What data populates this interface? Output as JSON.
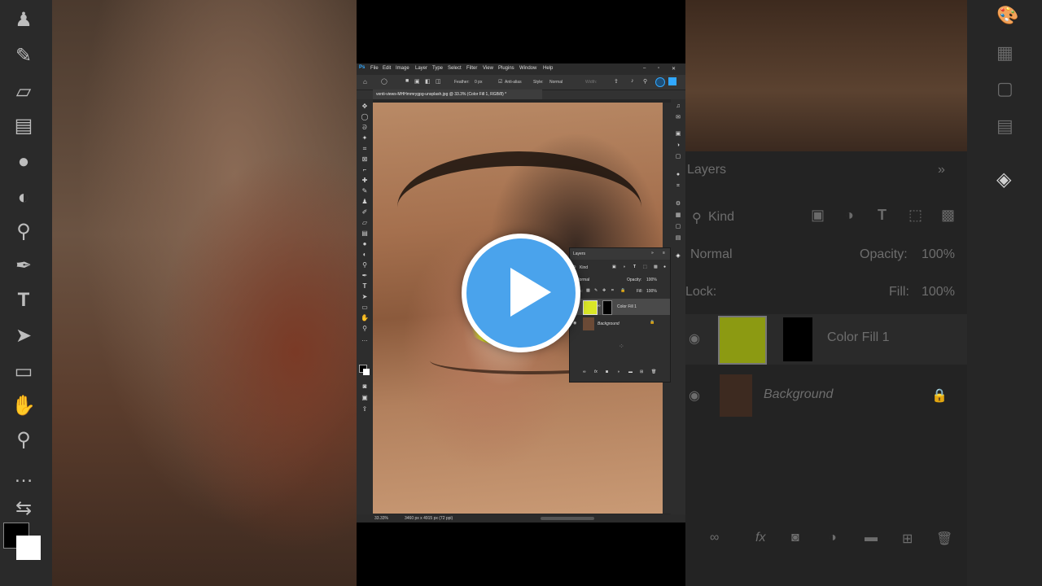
{
  "menu": [
    "File",
    "Edit",
    "Image",
    "Layer",
    "Type",
    "Select",
    "Filter",
    "View",
    "Plugins",
    "Window",
    "Help"
  ],
  "options": {
    "feather_label": "Feather:",
    "feather_value": "0 px",
    "antialias_label": "Anti-alias",
    "style_label": "Style:",
    "style_value": "Normal",
    "width_label": "Width:"
  },
  "document_tab": "venti-views-MHHmmrygpg-unsplash.jpg @ 33.3% (Color Fill 1, RGB/8) *",
  "status": {
    "zoom": "33.33%",
    "doc_info": "3460 px x 4915 px (72 ppi)"
  },
  "layers_panel": {
    "title": "Layers",
    "kind": "Kind",
    "blend_mode": "Normal",
    "opacity_label": "Opacity:",
    "opacity_value": "100%",
    "lock_label": "Lock:",
    "fill_label": "Fill:",
    "fill_value": "100%",
    "layers": [
      {
        "name": "Color Fill 1"
      },
      {
        "name": "Background"
      }
    ]
  },
  "big_layers": {
    "title": "Layers",
    "kind": "Kind",
    "blend_mode": "Normal",
    "opacity_label": "Opacity:",
    "opacity_value": "100%",
    "lock_label": "Lock:",
    "fill_label": "Fill:",
    "fill_value": "100%",
    "layer1": "Color Fill 1",
    "layer2": "Background"
  },
  "colors": {
    "fill_swatch": "#d9e627",
    "big_fill_swatch": "#8c9a12",
    "play": "#4aa3ec"
  }
}
